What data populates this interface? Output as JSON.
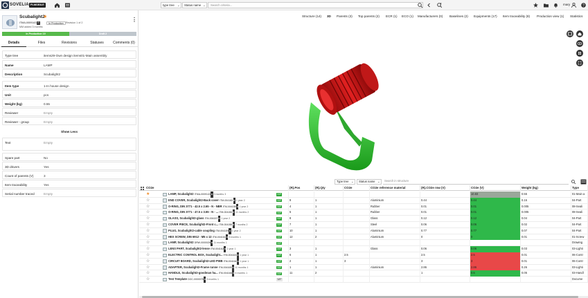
{
  "app": {
    "brand": "SOVELIA",
    "edition": "PLMOBILE",
    "top_search_placeholder": "Search criteria...",
    "type_tree_label": "type tree",
    "status_label": "Status name",
    "user": "mary"
  },
  "item": {
    "title": "Scubalight2",
    "id": "ITMA-0009143",
    "id_chip": "R",
    "lifecycle": "In Production",
    "revision": "Revision 1 of 2",
    "added": "MM added 3 months",
    "status_stage_1": "In Production 19",
    "status_stage_2": "Draft 2",
    "status_progress_fraction": 0.5
  },
  "left_tabs": [
    "Details",
    "Files",
    "Revisions",
    "Statuses",
    "Comments (0)"
  ],
  "properties": [
    {
      "label": "Type tree",
      "value": "items29-Own design items01-Main assembly"
    },
    {
      "label": "Name",
      "value": "LAMP"
    },
    {
      "label": "Description",
      "value": "Scubalight2"
    },
    {
      "label": "Item type",
      "value": "1-In house design"
    },
    {
      "label": "Unit",
      "value": "pcs"
    },
    {
      "label": "Weight (kg)",
      "value": "0.55"
    },
    {
      "label": "Reviewer",
      "value": "Empty"
    },
    {
      "label": "Reviewer - group",
      "value": "Empty"
    }
  ],
  "show_less": "Show Less",
  "properties2": [
    {
      "label": "Text",
      "value": "Empty"
    },
    {
      "label": "Spare part",
      "value": "No"
    },
    {
      "label": "3D drivers",
      "value": "Yes"
    },
    {
      "label": "Count of parents (V)",
      "value": "3"
    },
    {
      "label": "Item traceability",
      "value": "Yes"
    },
    {
      "label": "Serial number traced",
      "value": "Empty"
    }
  ],
  "right_tabs": [
    "Structure (14)",
    "3D",
    "Parents (3)",
    "Top parents (2)",
    "ECR (1)",
    "ECO (1)",
    "Manufacturers (0)",
    "Baselines (2)",
    "Equipments (17)",
    "Item traceability (8)",
    "Production view (1)",
    "Statistics"
  ],
  "structure": {
    "type_tree": "Type tree",
    "status": "Status name",
    "search_placeholder": "Search in structure",
    "columns": [
      "CO2e",
      "(R).Pos",
      "(R).Qty",
      "CO2e",
      "CO2e reference material",
      "(R).CO2e row (V)",
      "CO2e (V)",
      "Weight (kg)",
      "Type"
    ],
    "rows": [
      {
        "name": "LAMP, Scubalight2",
        "id": "ITMA-0009143",
        "age": "3 months",
        "cnt": "3",
        "tag": "INP",
        "pos": "",
        "qty": "",
        "co2": "",
        "mat": "",
        "row": "",
        "co2v": "10.83",
        "co2c": "#9aa79a",
        "weight": "0.55",
        "type": "01-Main a",
        "bold": true,
        "star": true
      },
      {
        "name": "END COVER, Scubalight2-Back cover",
        "id": "ITM-004160",
        "age": "1 year",
        "cnt": "2",
        "tag": "INP",
        "pos": "9",
        "qty": "1",
        "co2": "",
        "mat": "Aluminium",
        "row": "0.44",
        "co2v": "0.44",
        "co2c": "#2fb84a",
        "weight": "0.16",
        "type": "04-Part",
        "bold": true,
        "star": false
      },
      {
        "name": "O-RING, DIN 3771 - 42.5 x 2.65 - N - NBR",
        "id": "ITM-004155",
        "age": "1 year",
        "cnt": "2",
        "tag": "INP",
        "pos": "4",
        "qty": "1",
        "co2": "",
        "mat": "Rubber",
        "row": "0.01",
        "co2v": "0.01",
        "co2c": "#2fb84a",
        "weight": "0.005",
        "type": "08-Seali",
        "bold": true,
        "star": false
      },
      {
        "name": "O-RING, DIN 3771 - 47.5 x 3.55 - N - ...",
        "id": "ITM-004156",
        "age": "11 months",
        "cnt": "2",
        "tag": "INP",
        "pos": "5",
        "qty": "1",
        "co2": "",
        "mat": "Rubber",
        "row": "0.01",
        "co2v": "0.01",
        "co2c": "#2fb84a",
        "weight": "0.005",
        "type": "08-Seali",
        "bold": true,
        "star": false
      },
      {
        "name": "GLASS, Scubalight2-glass",
        "id": "ITM-004157",
        "age": "1 year",
        "cnt": "2",
        "tag": "INP",
        "pos": "8",
        "qty": "1",
        "co2": "",
        "mat": "Glass",
        "row": "0.12",
        "co2v": "0.12",
        "co2c": "#2fb84a",
        "weight": "0.04",
        "type": "04-Part",
        "bold": true,
        "star": false
      },
      {
        "name": "COVER PIECE, Scubalight2-Front c...",
        "id": "ITM-004158",
        "age": "7 months",
        "cnt": "2",
        "tag": "INP",
        "pos": "7",
        "qty": "1",
        "co2": "",
        "mat": "Steel",
        "row": "0.06",
        "co2v": "0.06",
        "co2c": "#2fb84a",
        "weight": "0.02",
        "type": "04-Part",
        "bold": true,
        "star": false
      },
      {
        "name": "PLUG, Scubalight2-cable coupling",
        "id": "ITM-004159",
        "age": "1 year",
        "cnt": "2",
        "tag": "INP",
        "pos": "10",
        "qty": "1",
        "co2": "",
        "mat": "Aluminium",
        "row": "0.77",
        "co2v": "0.77",
        "co2c": "#2fb84a",
        "weight": "0.07",
        "type": "04-Part",
        "bold": true,
        "star": false
      },
      {
        "name": "HEX SCREW, DIN 6912 - M5 x 12",
        "id": "ITM-004161",
        "age": "5 months",
        "cnt": "1",
        "tag": "INP",
        "pos": "12",
        "qty": "2",
        "co2": "",
        "mat": "Aluminium",
        "row": "0",
        "co2v": "0",
        "co2c": "#2fb84a",
        "weight": "0.01",
        "type": "01-Screw",
        "bold": true,
        "star": false
      },
      {
        "name": "LAMP, Scubalight2",
        "id": "DRW-0000026",
        "age": "11 months",
        "cnt": "1",
        "tag": "INP",
        "pos": "",
        "qty": "",
        "co2": "",
        "mat": "",
        "row": "",
        "co2v": "",
        "co2c": "",
        "weight": "",
        "type": "Drawing",
        "bold": true,
        "star": false
      },
      {
        "name": "LENS PART, Scubalight2-lense",
        "id": "ITM-004162",
        "age": "1 year",
        "cnt": "1",
        "tag": "INP",
        "pos": "3",
        "qty": "1",
        "co2": "",
        "mat": "Glass",
        "row": "0.06",
        "co2v": "0.06",
        "co2c": "#2fb84a",
        "weight": "0.03",
        "type": "03-Lighti",
        "bold": true,
        "star": false
      },
      {
        "name": "ELECTRIC CONTROL BOX, Scubalight...",
        "id": "ITM-004163",
        "age": "1 year",
        "cnt": "1",
        "tag": "INP",
        "pos": "6",
        "qty": "1",
        "co2": "2.5",
        "mat": "",
        "row": "2.5",
        "co2v": "2.5",
        "co2c": "#e84848",
        "weight": "0.01",
        "type": "06-Contr",
        "bold": true,
        "star": false
      },
      {
        "name": "CIRCUIT BOARD, Scubalight2-LED PWB",
        "id": "ITM-004164",
        "age": "1 year",
        "cnt": "1",
        "tag": "INP",
        "pos": "2",
        "qty": "1",
        "co2": "3",
        "mat": "",
        "row": "3",
        "co2v": "3",
        "co2c": "#e84848",
        "weight": "0.01",
        "type": "06-Contr",
        "bold": true,
        "star": false
      },
      {
        "name": "ADAPTER, Scubalight2-Frame runne",
        "id": "ITM-004165",
        "age": "11 months",
        "cnt": "1",
        "tag": "INP",
        "pos": "1",
        "qty": "1",
        "co2": "",
        "mat": "Aluminium",
        "row": "2.86",
        "co2v": "2.86",
        "co2c": "#e84848",
        "weight": "0.26",
        "type": "03-Lighti",
        "bold": true,
        "star": false
      },
      {
        "name": "HANDLE, Scubalight2-goodman ha...",
        "id": "ITM-004166",
        "age": "6 months",
        "cnt": "1",
        "tag": "INP",
        "pos": "11",
        "qty": "2",
        "co2": "",
        "mat": "",
        "row": "1",
        "co2v": "0.5",
        "co2c": "#2fb84a",
        "weight": "0.05",
        "type": "03-Handl",
        "bold": true,
        "star": false
      },
      {
        "name": "Test Template",
        "id": "DOC-0000078",
        "age": "5 months",
        "cnt": "1",
        "tag": "WIP",
        "pos": "",
        "qty": "",
        "co2": "",
        "mat": "",
        "row": "",
        "co2v": "",
        "co2c": "",
        "weight": "",
        "type": "Docume",
        "bold": true,
        "star": false
      }
    ]
  }
}
